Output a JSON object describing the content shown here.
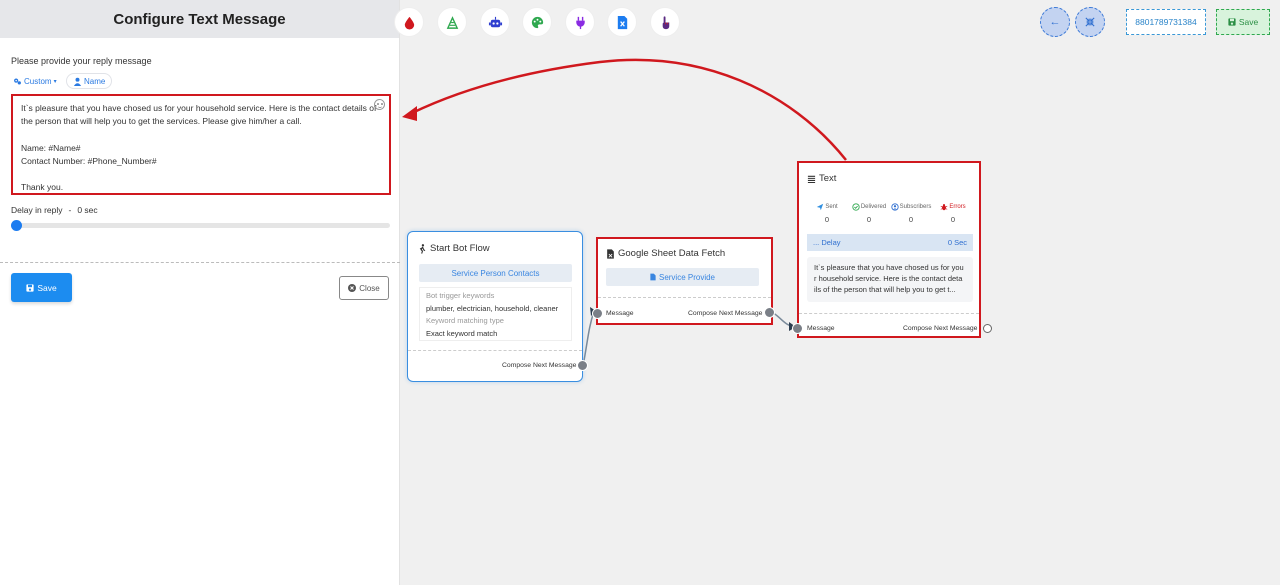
{
  "panel": {
    "title": "Configure Text Message",
    "prompt": "Please provide your reply message",
    "chips": {
      "custom": "Custom",
      "name": "Name"
    },
    "message_lines": [
      "It`s pleasure that you have chosed us for your household service. Here is the contact details of the person that will help you to get the services. Please give him/her a call.",
      "",
      "Name: #Name#",
      "Contact Number: #Phone_Number#",
      "",
      "Thank you."
    ],
    "delay_label": "Delay in reply",
    "delay_sep": "-",
    "delay_value": "0 sec",
    "delay_fraction": 0,
    "save_label": "Save",
    "close_label": "Close"
  },
  "toolbar": {
    "tools": [
      "drop-icon",
      "sheet-flow-icon",
      "robot-icon",
      "palette-icon",
      "plug-icon",
      "excel-file-icon",
      "touch-icon"
    ],
    "back_icon": "arrow-left-icon",
    "fit_icon": "compress-icon",
    "phone": "8801789731384",
    "save_label": "Save"
  },
  "nodes": {
    "start": {
      "title": "Start Bot Flow",
      "sub_button": "Service Person Contacts",
      "trigger_label": "Bot trigger keywords",
      "trigger_value": "plumber, electrician, household, cleaner",
      "match_label": "Keyword matching type",
      "match_value": "Exact keyword match",
      "out_label": "Compose Next Message"
    },
    "sheet": {
      "title": "Google Sheet Data Fetch",
      "sub_button": "Service Provide",
      "in_label": "Message",
      "out_label": "Compose Next Message"
    },
    "text": {
      "title": "Text",
      "stats": [
        {
          "label": "Sent",
          "value": "0",
          "color": "#2f8fe0"
        },
        {
          "label": "Delivered",
          "value": "0",
          "color": "#2fa84f"
        },
        {
          "label": "Subscribers",
          "value": "0",
          "color": "#2f6fd0"
        },
        {
          "label": "Errors",
          "value": "0",
          "color": "#d0181e"
        }
      ],
      "delay_label": "... Delay",
      "delay_value": "0 Sec",
      "preview": "It`s pleasure that you have chosed us for you r household service. Here is the contact deta ils of the person that will help you to get t...",
      "in_label": "Message",
      "out_label": "Compose Next Message"
    }
  },
  "colors": {
    "highlight": "#d0181e",
    "accent": "#1c8cf0"
  }
}
